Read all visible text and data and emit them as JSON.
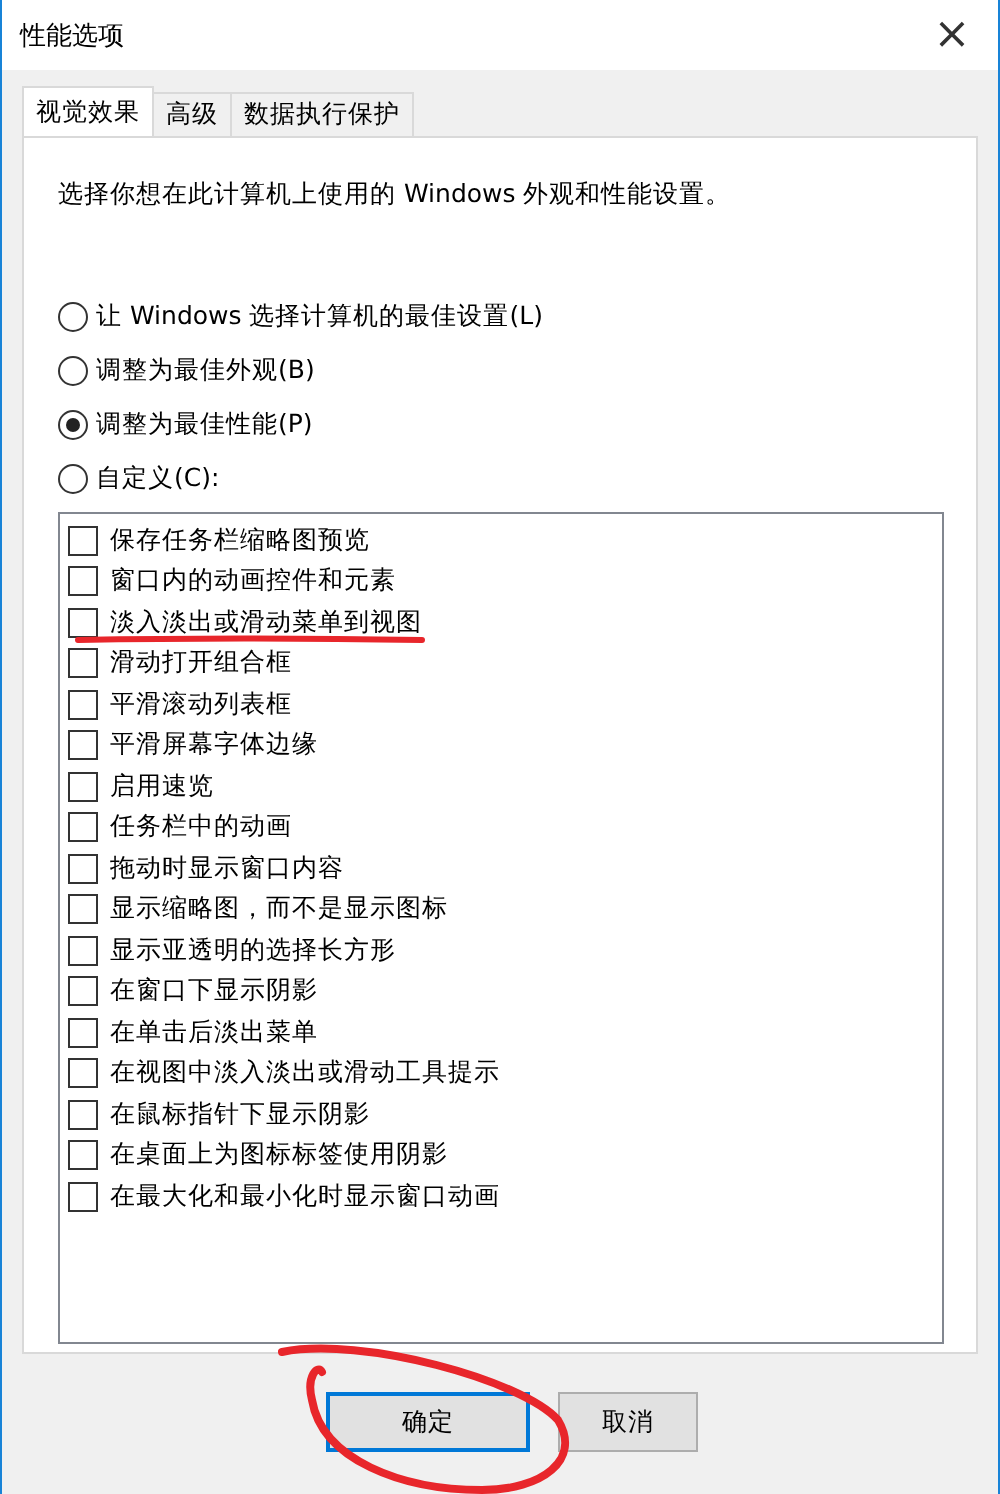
{
  "window": {
    "title": "性能选项",
    "close": "×"
  },
  "tabs": [
    {
      "label": "视觉效果",
      "selected": true
    },
    {
      "label": "高级",
      "selected": false
    },
    {
      "label": "数据执行保护",
      "selected": false
    }
  ],
  "intro": "选择你想在此计算机上使用的 Windows 外观和性能设置。",
  "options": [
    {
      "label": "让 Windows 选择计算机的最佳设置(L)",
      "selected": false
    },
    {
      "label": "调整为最佳外观(B)",
      "selected": false
    },
    {
      "label": "调整为最佳性能(P)",
      "selected": true
    },
    {
      "label": "自定义(C):",
      "selected": false
    }
  ],
  "effects": [
    {
      "label": "保存任务栏缩略图预览",
      "checked": false
    },
    {
      "label": "窗口内的动画控件和元素",
      "checked": false
    },
    {
      "label": "淡入淡出或滑动菜单到视图",
      "checked": false
    },
    {
      "label": "滑动打开组合框",
      "checked": false
    },
    {
      "label": "平滑滚动列表框",
      "checked": false
    },
    {
      "label": "平滑屏幕字体边缘",
      "checked": false
    },
    {
      "label": "启用速览",
      "checked": false
    },
    {
      "label": "任务栏中的动画",
      "checked": false
    },
    {
      "label": "拖动时显示窗口内容",
      "checked": false
    },
    {
      "label": "显示缩略图，而不是显示图标",
      "checked": false
    },
    {
      "label": "显示亚透明的选择长方形",
      "checked": false
    },
    {
      "label": "在窗口下显示阴影",
      "checked": false
    },
    {
      "label": "在单击后淡出菜单",
      "checked": false
    },
    {
      "label": "在视图中淡入淡出或滑动工具提示",
      "checked": false
    },
    {
      "label": "在鼠标指针下显示阴影",
      "checked": false
    },
    {
      "label": "在桌面上为图标标签使用阴影",
      "checked": false
    },
    {
      "label": "在最大化和最小化时显示窗口动画",
      "checked": false
    }
  ],
  "buttons": [
    {
      "label": "确定",
      "default": true
    },
    {
      "label": "取消",
      "default": false
    }
  ]
}
